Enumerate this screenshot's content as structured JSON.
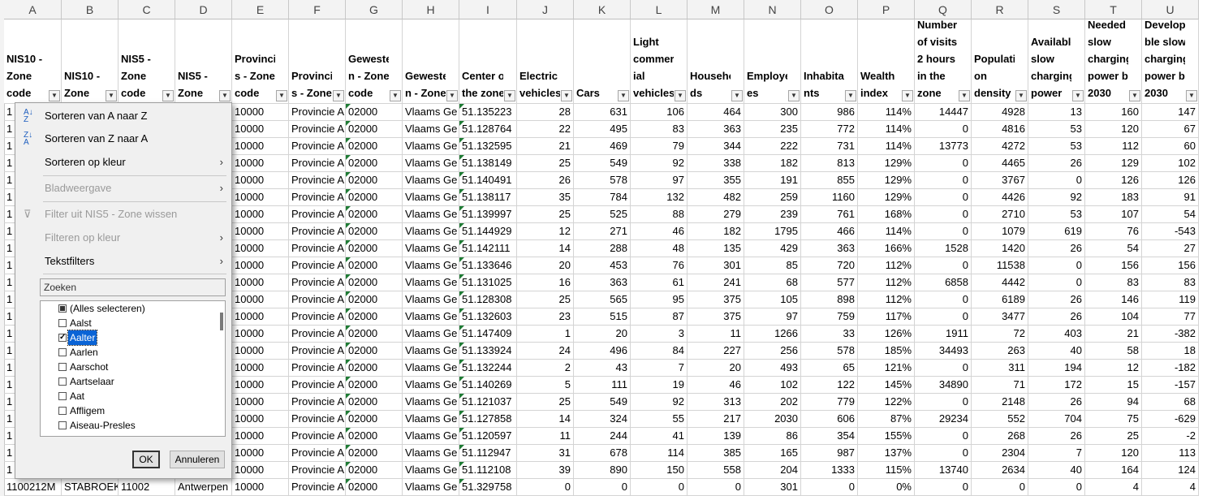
{
  "columns": [
    {
      "letter": "A",
      "header": "NIS10 -\nZone\ncode"
    },
    {
      "letter": "B",
      "header": "NIS10 -\nZone"
    },
    {
      "letter": "C",
      "header": "NIS5 -\nZone\ncode"
    },
    {
      "letter": "D",
      "header": "NIS5 -\nZone"
    },
    {
      "letter": "E",
      "header": "Provincie\ns - Zone\ncode"
    },
    {
      "letter": "F",
      "header": "Provincie\ns - Zone"
    },
    {
      "letter": "G",
      "header": "Geweste\nn - Zone\ncode"
    },
    {
      "letter": "H",
      "header": "Geweste\nn - Zone"
    },
    {
      "letter": "I",
      "header": "Center of\nthe zone"
    },
    {
      "letter": "J",
      "header": "Electric\nvehicles"
    },
    {
      "letter": "K",
      "header": "Cars"
    },
    {
      "letter": "L",
      "header": "Light\ncommerc\nial\nvehicles"
    },
    {
      "letter": "M",
      "header": "Househol\nds"
    },
    {
      "letter": "N",
      "header": "Employe\nes"
    },
    {
      "letter": "O",
      "header": "Inhabita\nnts"
    },
    {
      "letter": "P",
      "header": "Wealth\nindex"
    },
    {
      "letter": "Q",
      "header": "Number\nof visits >\n2 hours\nin the\nzone"
    },
    {
      "letter": "R",
      "header": "Populati\non\ndensity"
    },
    {
      "letter": "S",
      "header": "Available\nslow\ncharging\npower"
    },
    {
      "letter": "T",
      "header": "Needed\nslow\ncharging\npower by\n2030"
    },
    {
      "letter": "U",
      "header": "Developa\nble slow\ncharging\npower by\n2030"
    }
  ],
  "rows": [
    [
      "1",
      "",
      "",
      "",
      "10000",
      "Provincie A",
      "02000",
      "Vlaams Ge",
      "51.135223",
      "28",
      "631",
      "106",
      "464",
      "300",
      "986",
      "114%",
      "14447",
      "4928",
      "13",
      "160",
      "147"
    ],
    [
      "1",
      "",
      "",
      "",
      "10000",
      "Provincie A",
      "02000",
      "Vlaams Ge",
      "51.128764",
      "22",
      "495",
      "83",
      "363",
      "235",
      "772",
      "114%",
      "0",
      "4816",
      "53",
      "120",
      "67"
    ],
    [
      "1",
      "",
      "",
      "",
      "10000",
      "Provincie A",
      "02000",
      "Vlaams Ge",
      "51.132595",
      "21",
      "469",
      "79",
      "344",
      "222",
      "731",
      "114%",
      "13773",
      "4272",
      "53",
      "112",
      "60"
    ],
    [
      "1",
      "",
      "",
      "",
      "10000",
      "Provincie A",
      "02000",
      "Vlaams Ge",
      "51.138149",
      "25",
      "549",
      "92",
      "338",
      "182",
      "813",
      "129%",
      "0",
      "4465",
      "26",
      "129",
      "102"
    ],
    [
      "1",
      "",
      "",
      "",
      "10000",
      "Provincie A",
      "02000",
      "Vlaams Ge",
      "51.140491",
      "26",
      "578",
      "97",
      "355",
      "191",
      "855",
      "129%",
      "0",
      "3767",
      "0",
      "126",
      "126"
    ],
    [
      "1",
      "",
      "",
      "",
      "10000",
      "Provincie A",
      "02000",
      "Vlaams Ge",
      "51.138117",
      "35",
      "784",
      "132",
      "482",
      "259",
      "1160",
      "129%",
      "0",
      "4426",
      "92",
      "183",
      "91"
    ],
    [
      "1",
      "",
      "",
      "",
      "10000",
      "Provincie A",
      "02000",
      "Vlaams Ge",
      "51.139997",
      "25",
      "525",
      "88",
      "279",
      "239",
      "761",
      "168%",
      "0",
      "2710",
      "53",
      "107",
      "54"
    ],
    [
      "1",
      "",
      "",
      "",
      "10000",
      "Provincie A",
      "02000",
      "Vlaams Ge",
      "51.144929",
      "12",
      "271",
      "46",
      "182",
      "1795",
      "466",
      "114%",
      "0",
      "1079",
      "619",
      "76",
      "-543"
    ],
    [
      "1",
      "",
      "",
      "",
      "10000",
      "Provincie A",
      "02000",
      "Vlaams Ge",
      "51.142111",
      "14",
      "288",
      "48",
      "135",
      "429",
      "363",
      "166%",
      "1528",
      "1420",
      "26",
      "54",
      "27"
    ],
    [
      "1",
      "",
      "",
      "",
      "10000",
      "Provincie A",
      "02000",
      "Vlaams Ge",
      "51.133646",
      "20",
      "453",
      "76",
      "301",
      "85",
      "720",
      "112%",
      "0",
      "11538",
      "0",
      "156",
      "156"
    ],
    [
      "1",
      "",
      "",
      "",
      "10000",
      "Provincie A",
      "02000",
      "Vlaams Ge",
      "51.131025",
      "16",
      "363",
      "61",
      "241",
      "68",
      "577",
      "112%",
      "6858",
      "4442",
      "0",
      "83",
      "83"
    ],
    [
      "1",
      "",
      "",
      "",
      "10000",
      "Provincie A",
      "02000",
      "Vlaams Ge",
      "51.128308",
      "25",
      "565",
      "95",
      "375",
      "105",
      "898",
      "112%",
      "0",
      "6189",
      "26",
      "146",
      "119"
    ],
    [
      "1",
      "",
      "",
      "",
      "10000",
      "Provincie A",
      "02000",
      "Vlaams Ge",
      "51.132603",
      "23",
      "515",
      "87",
      "375",
      "97",
      "759",
      "117%",
      "0",
      "3477",
      "26",
      "104",
      "77"
    ],
    [
      "1",
      "",
      "",
      "",
      "10000",
      "Provincie A",
      "02000",
      "Vlaams Ge",
      "51.147409",
      "1",
      "20",
      "3",
      "11",
      "1266",
      "33",
      "126%",
      "1911",
      "72",
      "403",
      "21",
      "-382"
    ],
    [
      "1",
      "",
      "",
      "",
      "10000",
      "Provincie A",
      "02000",
      "Vlaams Ge",
      "51.133924",
      "24",
      "496",
      "84",
      "227",
      "256",
      "578",
      "185%",
      "34493",
      "263",
      "40",
      "58",
      "18"
    ],
    [
      "1",
      "",
      "",
      "",
      "10000",
      "Provincie A",
      "02000",
      "Vlaams Ge",
      "51.132244",
      "2",
      "43",
      "7",
      "20",
      "493",
      "65",
      "121%",
      "0",
      "311",
      "194",
      "12",
      "-182"
    ],
    [
      "1",
      "",
      "",
      "",
      "10000",
      "Provincie A",
      "02000",
      "Vlaams Ge",
      "51.140269",
      "5",
      "111",
      "19",
      "46",
      "102",
      "122",
      "145%",
      "34890",
      "71",
      "172",
      "15",
      "-157"
    ],
    [
      "1",
      "",
      "",
      "",
      "10000",
      "Provincie A",
      "02000",
      "Vlaams Ge",
      "51.121037",
      "25",
      "549",
      "92",
      "313",
      "202",
      "779",
      "122%",
      "0",
      "2148",
      "26",
      "94",
      "68"
    ],
    [
      "1",
      "",
      "",
      "",
      "10000",
      "Provincie A",
      "02000",
      "Vlaams Ge",
      "51.127858",
      "14",
      "324",
      "55",
      "217",
      "2030",
      "606",
      "87%",
      "29234",
      "552",
      "704",
      "75",
      "-629"
    ],
    [
      "1",
      "",
      "",
      "",
      "10000",
      "Provincie A",
      "02000",
      "Vlaams Ge",
      "51.120597",
      "11",
      "244",
      "41",
      "139",
      "86",
      "354",
      "155%",
      "0",
      "268",
      "26",
      "25",
      "-2"
    ],
    [
      "1",
      "",
      "",
      "",
      "10000",
      "Provincie A",
      "02000",
      "Vlaams Ge",
      "51.112947",
      "31",
      "678",
      "114",
      "385",
      "165",
      "987",
      "137%",
      "0",
      "2304",
      "7",
      "120",
      "113"
    ],
    [
      "1",
      "",
      "",
      "",
      "10000",
      "Provincie A",
      "02000",
      "Vlaams Ge",
      "51.112108",
      "39",
      "890",
      "150",
      "558",
      "204",
      "1333",
      "115%",
      "13740",
      "2634",
      "40",
      "164",
      "124"
    ],
    [
      "1100212M",
      "STABROEK",
      "11002",
      "Antwerpen",
      "10000",
      "Provincie A",
      "02000",
      "Vlaams Ge",
      "51.329758",
      "0",
      "0",
      "0",
      "0",
      "301",
      "0",
      "0%",
      "0",
      "0",
      "0",
      "4",
      "4"
    ]
  ],
  "filter_menu": {
    "sort_az": "Sorteren van A naar Z",
    "sort_za": "Sorteren van Z naar A",
    "sort_color": "Sorteren op kleur",
    "sheet_view": "Bladweergave",
    "clear_filter": "Filter uit NIS5 - Zone wissen",
    "filter_color": "Filteren op kleur",
    "text_filters": "Tekstfilters",
    "search_placeholder": "Zoeken",
    "items": [
      {
        "label": "(Alles selecteren)",
        "state": "indeterminate"
      },
      {
        "label": "Aalst",
        "state": "unchecked"
      },
      {
        "label": "Aalter",
        "state": "checked",
        "selected": true
      },
      {
        "label": "Aarlen",
        "state": "unchecked"
      },
      {
        "label": "Aarschot",
        "state": "unchecked"
      },
      {
        "label": "Aartselaar",
        "state": "unchecked"
      },
      {
        "label": "Aat",
        "state": "unchecked"
      },
      {
        "label": "Affligem",
        "state": "unchecked"
      },
      {
        "label": "Aiseau-Presles",
        "state": "unchecked"
      }
    ],
    "ok_label": "OK",
    "cancel_label": "Annuleren",
    "icons": {
      "sort_az": "sort-ascending-icon",
      "sort_za": "sort-descending-icon",
      "clear": "filter-clear-icon"
    }
  },
  "colors": {
    "accent": "#0a64d6",
    "green_triangle": "#1e7b34"
  }
}
